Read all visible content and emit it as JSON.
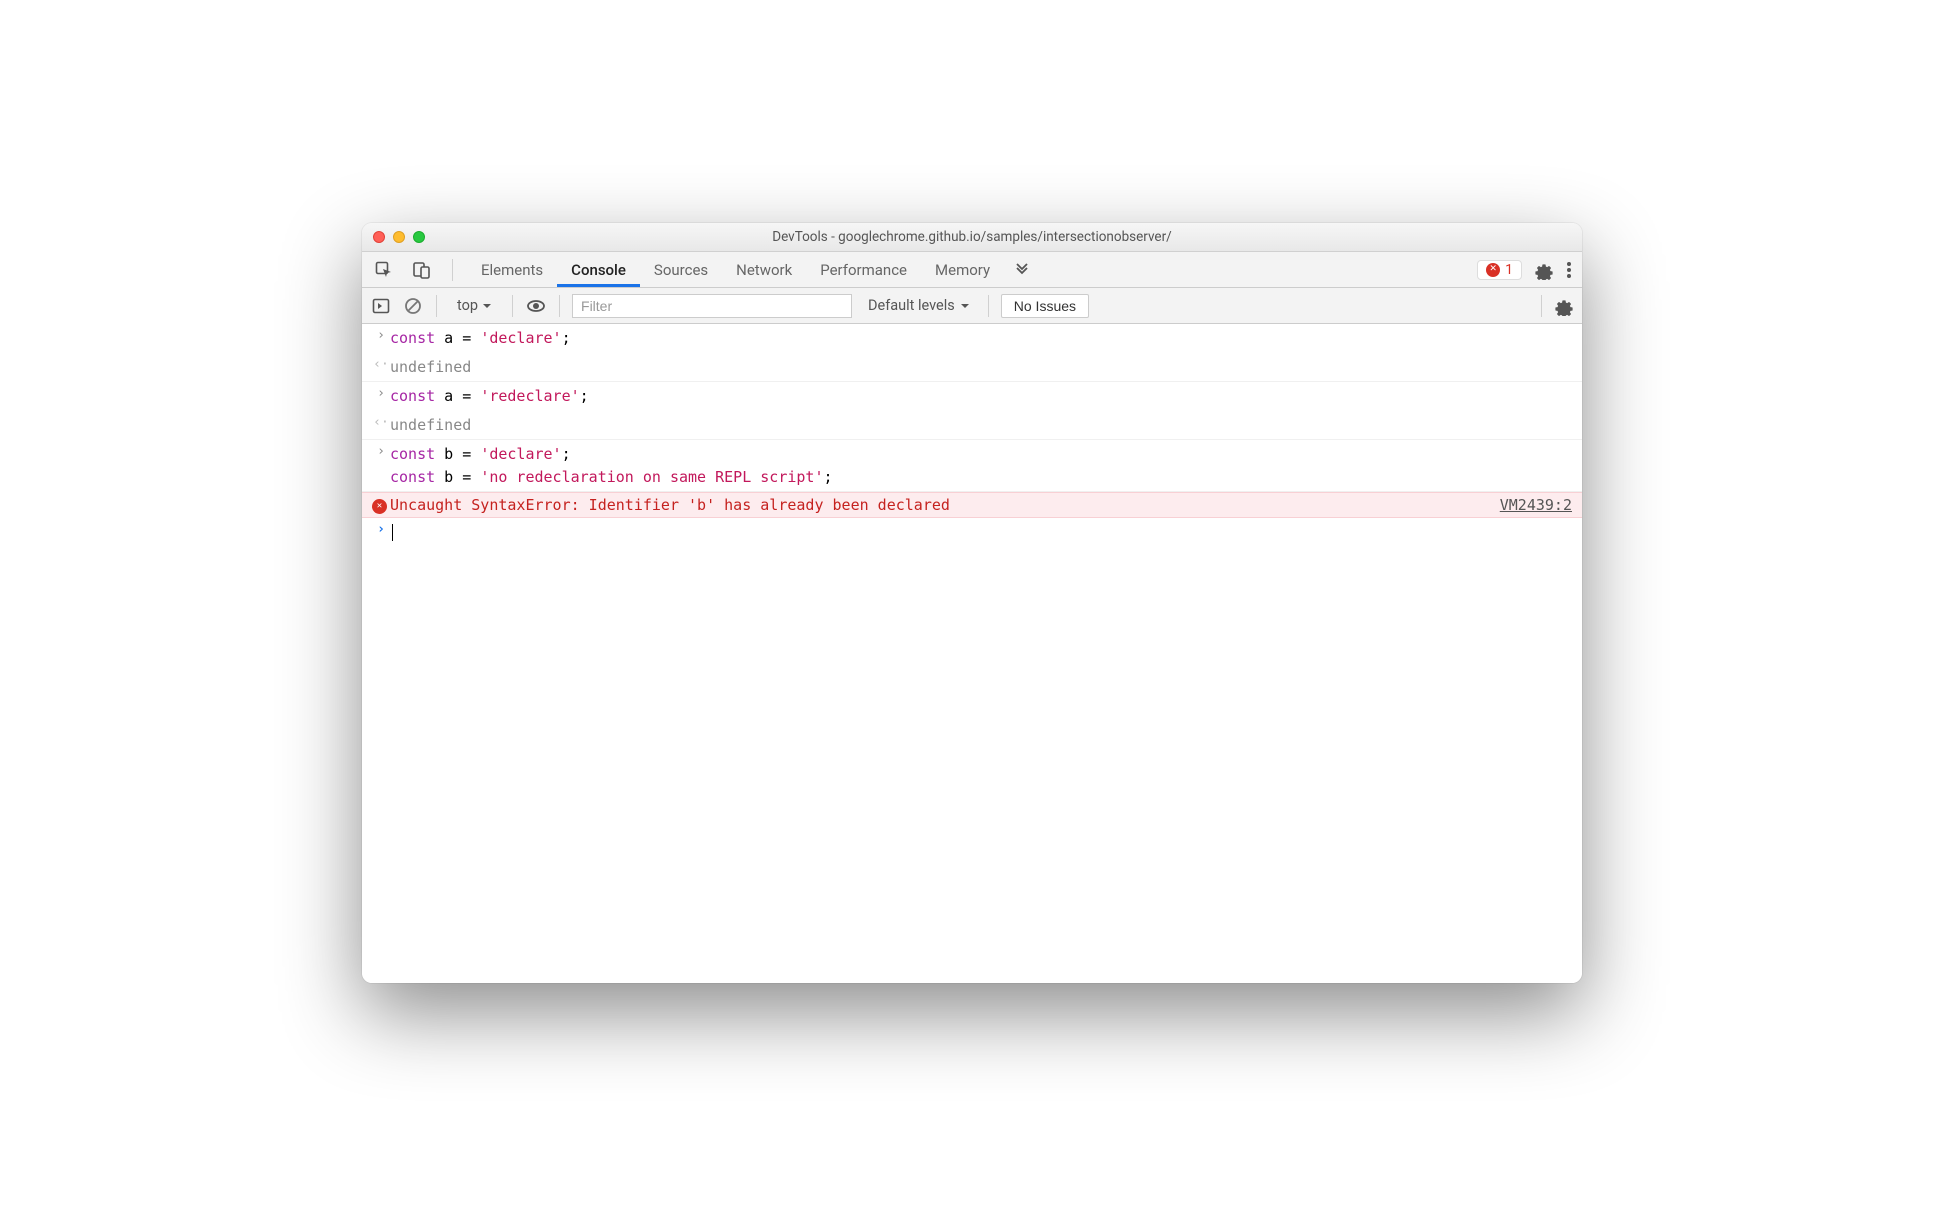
{
  "window": {
    "title": "DevTools - googlechrome.github.io/samples/intersectionobserver/"
  },
  "tabs": {
    "elements": "Elements",
    "console": "Console",
    "sources": "Sources",
    "network": "Network",
    "performance": "Performance",
    "memory": "Memory",
    "error_count": "1"
  },
  "subbar": {
    "context": "top",
    "filter_placeholder": "Filter",
    "levels_label": "Default levels",
    "no_issues": "No Issues"
  },
  "console": {
    "line1_kw": "const",
    "line1_rest": " a = ",
    "line1_str": "'declare'",
    "line1_end": ";",
    "line2": "undefined",
    "line3_kw": "const",
    "line3_rest": " a = ",
    "line3_str": "'redeclare'",
    "line3_end": ";",
    "line4": "undefined",
    "line5a_kw": "const",
    "line5a_rest": " b = ",
    "line5a_str": "'declare'",
    "line5a_end": ";",
    "line5b_kw": "const",
    "line5b_rest": " b = ",
    "line5b_str": "'no redeclaration on same REPL script'",
    "line5b_end": ";",
    "error_text": "Uncaught SyntaxError: Identifier 'b' has already been declared",
    "error_source": "VM2439:2"
  }
}
